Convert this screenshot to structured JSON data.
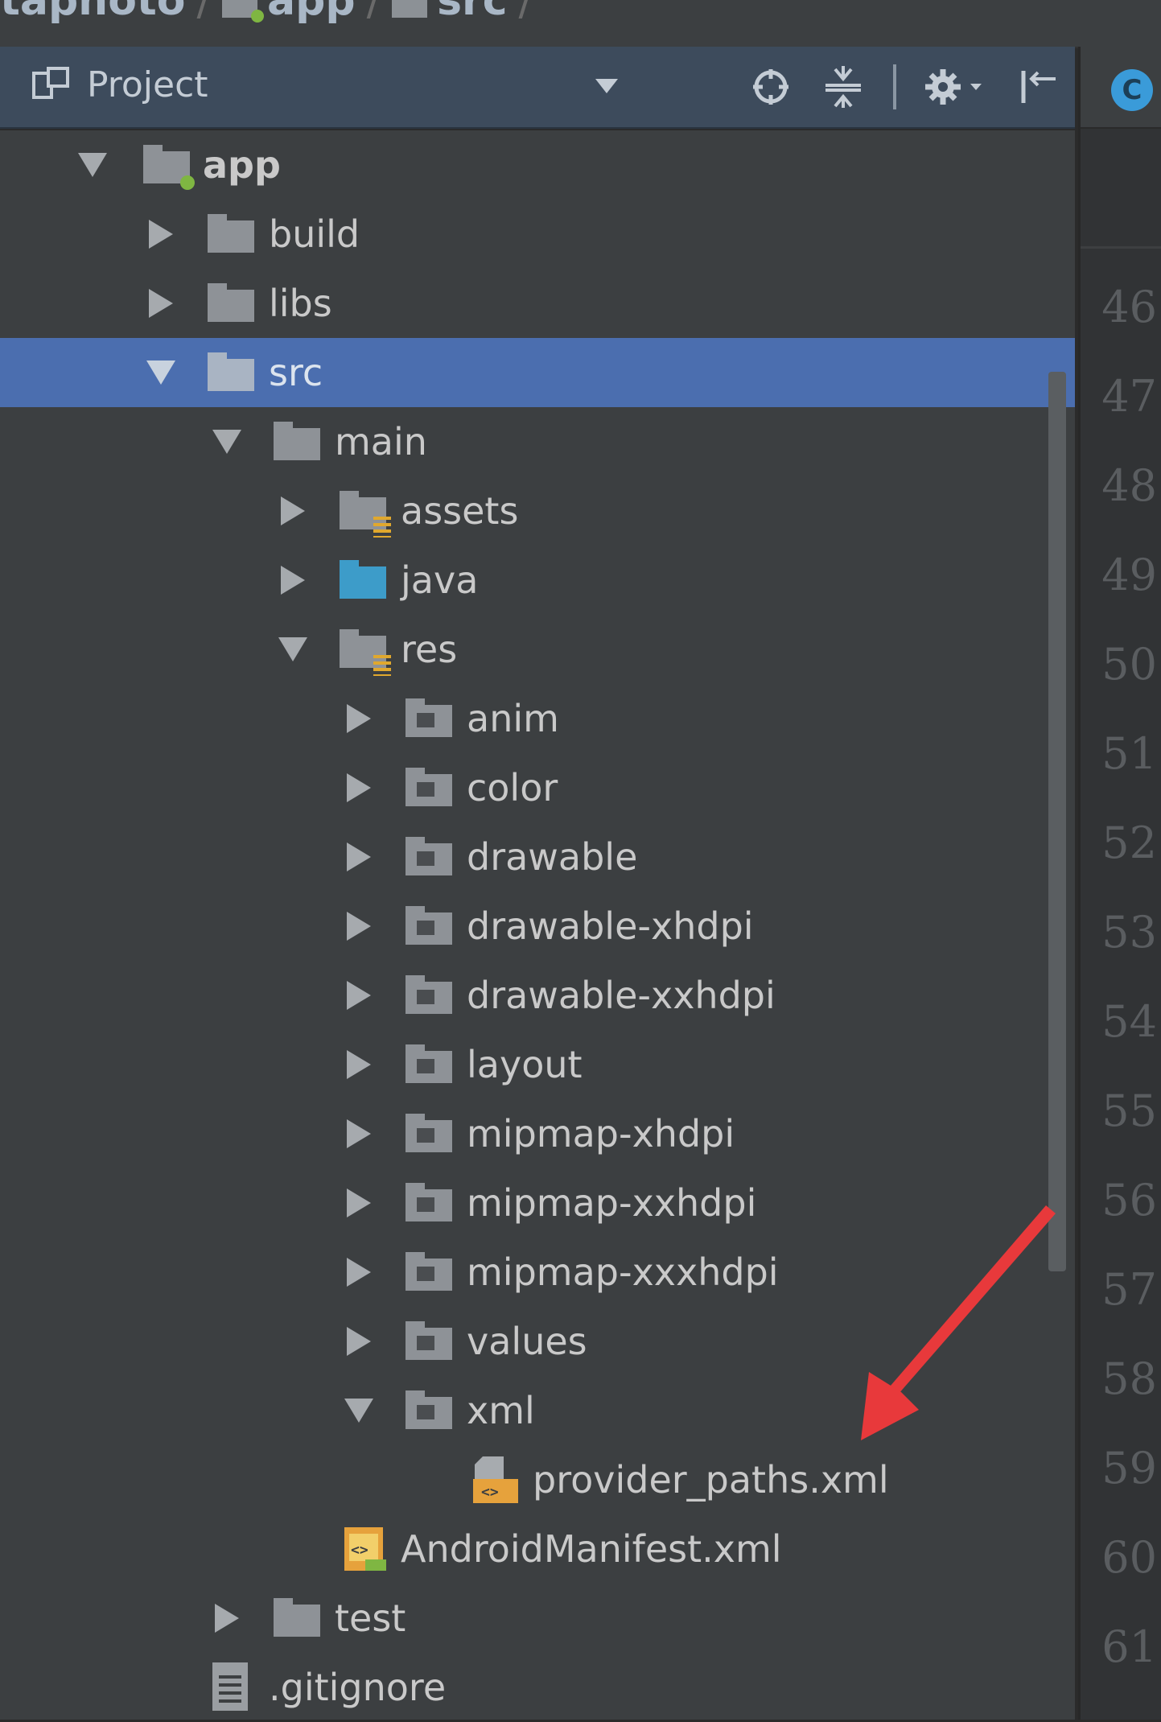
{
  "breadcrumb": {
    "items": [
      "tapnoto",
      "app",
      "src"
    ]
  },
  "tool_window": {
    "title": "Project",
    "tools": [
      "locate-icon",
      "collapse-all-icon",
      "settings-icon",
      "hide-icon"
    ]
  },
  "editor": {
    "tab_icon_letter": "C",
    "line_numbers": [
      "46",
      "47",
      "48",
      "49",
      "50",
      "51",
      "52",
      "53",
      "54",
      "55",
      "56",
      "57",
      "58",
      "59",
      "60",
      "61"
    ]
  },
  "tree": {
    "app": "app",
    "build": "build",
    "libs": "libs",
    "src": "src",
    "main": "main",
    "assets": "assets",
    "java": "java",
    "res": "res",
    "anim": "anim",
    "color": "color",
    "drawable": "drawable",
    "drawable_xhdpi": "drawable-xhdpi",
    "drawable_xxhdpi": "drawable-xxhdpi",
    "layout": "layout",
    "mipmap_xhdpi": "mipmap-xhdpi",
    "mipmap_xxhdpi": "mipmap-xxhdpi",
    "mipmap_xxxhdpi": "mipmap-xxxhdpi",
    "values": "values",
    "xml": "xml",
    "provider_paths": "provider_paths.xml",
    "manifest": "AndroidManifest.xml",
    "test": "test",
    "gitignore": ".gitignore"
  },
  "colors": {
    "selection": "#4b6eaf",
    "header": "#3d4b5c",
    "annotation_arrow": "#e8393b"
  }
}
